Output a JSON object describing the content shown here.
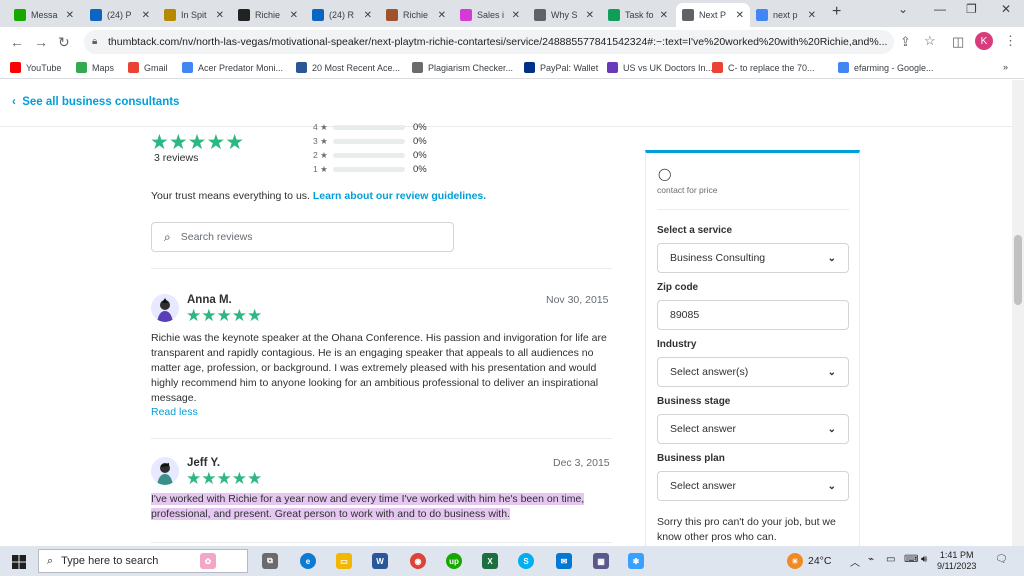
{
  "browser": {
    "tabs": [
      {
        "title": "Messa",
        "icon": "upwork-icon",
        "color": "#14a800"
      },
      {
        "title": "(24) P",
        "icon": "linkedin-icon",
        "color": "#0a66c2"
      },
      {
        "title": "In Spit",
        "icon": "g-icon",
        "color": "#b58a00"
      },
      {
        "title": "Richie",
        "icon": "z-icon",
        "color": "#222222"
      },
      {
        "title": "(24) R",
        "icon": "linkedin-icon",
        "color": "#0a66c2"
      },
      {
        "title": "Richie",
        "icon": "avatar-icon",
        "color": "#a0522d"
      },
      {
        "title": "Sales i",
        "icon": "chevrons-icon",
        "color": "#d63ad6"
      },
      {
        "title": "Why S",
        "icon": "globe-icon",
        "color": "#5f6368"
      },
      {
        "title": "Task fo",
        "icon": "sheets-icon",
        "color": "#0f9d58"
      },
      {
        "title": "Next P",
        "icon": "globe-icon",
        "color": "#5f6368",
        "active": true
      },
      {
        "title": "next p",
        "icon": "google-icon",
        "color": "#4285f4"
      }
    ],
    "url": "thumbtack.com/nv/north-las-vegas/motivational-speaker/next-playtm-richie-contartesi/service/248885577841542324#:~:text=I've%20worked%20with%20Richie,and%...",
    "profile_initial": "K",
    "bookmarks": [
      {
        "label": "YouTube",
        "icon": "youtube-icon",
        "color": "#ff0000"
      },
      {
        "label": "Maps",
        "icon": "maps-icon",
        "color": "#34a853"
      },
      {
        "label": "Gmail",
        "icon": "gmail-icon",
        "color": "#ea4335"
      },
      {
        "label": "Acer Predator Moni...",
        "icon": "google-icon",
        "color": "#4285f4"
      },
      {
        "label": "20 Most Recent Ace...",
        "icon": "site-icon",
        "color": "#2b5797"
      },
      {
        "label": "Plagiarism Checker...",
        "icon": "sst-icon",
        "color": "#6b6b6b"
      },
      {
        "label": "PayPal: Wallet",
        "icon": "paypal-icon",
        "color": "#003087"
      },
      {
        "label": "US vs UK Doctors In...",
        "icon": "forms-icon",
        "color": "#673ab7"
      },
      {
        "label": "C- to replace the 70...",
        "icon": "gmail-icon",
        "color": "#ea4335"
      },
      {
        "label": "efarming - Google...",
        "icon": "docs-icon",
        "color": "#4285f4"
      }
    ]
  },
  "page": {
    "back_link": "See all business consultants",
    "rating_stars": "★★★★★",
    "review_count": "3 reviews",
    "distribution": [
      {
        "label": "4 ★",
        "pct": "0%"
      },
      {
        "label": "3 ★",
        "pct": "0%"
      },
      {
        "label": "2 ★",
        "pct": "0%"
      },
      {
        "label": "1 ★",
        "pct": "0%"
      }
    ],
    "trust_text": "Your trust means everything to us. ",
    "trust_link": "Learn about our review guidelines.",
    "search_placeholder": "Search reviews",
    "reviews": [
      {
        "name": "Anna M.",
        "stars": "★★★★★",
        "date": "Nov 30, 2015",
        "text": "Richie was the keynote speaker at the Ohana Conference. His passion and invigoration for life are transparent and rapidly contagious. He is an engaging speaker that appeals to all audiences no matter age, profession, or background. I was extremely pleased with his presentation and would highly recommend him to anyone looking for an ambitious professional to deliver an inspirational message.",
        "read_less": "Read less"
      },
      {
        "name": "Jeff Y.",
        "stars": "★★★★★",
        "date": "Dec 3, 2015",
        "text": "I've worked with Richie for a year now and every time I've worked with him he's been on time, professional, and present. Great person to work with and to do business with."
      }
    ]
  },
  "panel": {
    "contact": "contact for price",
    "service_label": "Select a service",
    "service_value": "Business Consulting",
    "zip_label": "Zip code",
    "zip_value": "89085",
    "industry_label": "Industry",
    "industry_value": "Select answer(s)",
    "stage_label": "Business stage",
    "stage_value": "Select answer",
    "plan_label": "Business plan",
    "plan_value": "Select answer",
    "sorry": "Sorry this pro can't do your job, but we know other pros who can."
  },
  "taskbar": {
    "search_placeholder": "Type here to search",
    "temperature": "24°C",
    "time": "1:41 PM",
    "date": "9/11/2023"
  }
}
